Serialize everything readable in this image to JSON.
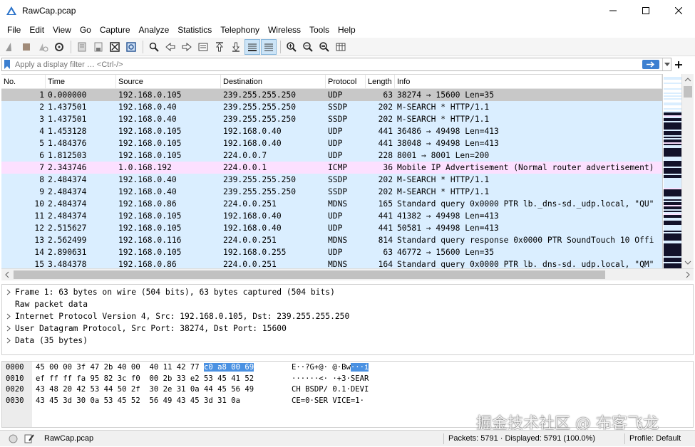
{
  "window": {
    "title": "RawCap.pcap"
  },
  "menu": [
    "File",
    "Edit",
    "View",
    "Go",
    "Capture",
    "Analyze",
    "Statistics",
    "Telephony",
    "Wireless",
    "Tools",
    "Help"
  ],
  "toolbar_icons": [
    "shark-fin-icon",
    "stop-icon",
    "restart-icon",
    "options-icon",
    "open-icon",
    "save-icon",
    "close-file-icon",
    "reload-icon",
    "find-icon",
    "back-icon",
    "forward-icon",
    "go-to-packet-icon",
    "first-packet-icon",
    "last-packet-icon",
    "autoscroll-icon",
    "colorize-icon",
    "zoom-in-icon",
    "zoom-out-icon",
    "normal-size-icon",
    "resize-columns-icon"
  ],
  "filter": {
    "placeholder": "Apply a display filter … <Ctrl-/>"
  },
  "packet_list": {
    "columns": [
      "No.",
      "Time",
      "Source",
      "Destination",
      "Protocol",
      "Length",
      "Info"
    ],
    "rows": [
      {
        "no": "1",
        "time": "0.000000",
        "src": "192.168.0.105",
        "dst": "239.255.255.250",
        "proto": "UDP",
        "len": "63",
        "info": "38274 → 15600 Len=35",
        "color": "#c8c8c8"
      },
      {
        "no": "2",
        "time": "1.437501",
        "src": "192.168.0.40",
        "dst": "239.255.255.250",
        "proto": "SSDP",
        "len": "202",
        "info": "M-SEARCH * HTTP/1.1",
        "color": "#daeeff"
      },
      {
        "no": "3",
        "time": "1.437501",
        "src": "192.168.0.40",
        "dst": "239.255.255.250",
        "proto": "SSDP",
        "len": "202",
        "info": "M-SEARCH * HTTP/1.1",
        "color": "#daeeff"
      },
      {
        "no": "4",
        "time": "1.453128",
        "src": "192.168.0.105",
        "dst": "192.168.0.40",
        "proto": "UDP",
        "len": "441",
        "info": "36486 → 49498 Len=413",
        "color": "#daeeff"
      },
      {
        "no": "5",
        "time": "1.484376",
        "src": "192.168.0.105",
        "dst": "192.168.0.40",
        "proto": "UDP",
        "len": "441",
        "info": "38048 → 49498 Len=413",
        "color": "#daeeff"
      },
      {
        "no": "6",
        "time": "1.812503",
        "src": "192.168.0.105",
        "dst": "224.0.0.7",
        "proto": "UDP",
        "len": "228",
        "info": "8001 → 8001 Len=200",
        "color": "#daeeff"
      },
      {
        "no": "7",
        "time": "2.343746",
        "src": "1.0.168.192",
        "dst": "224.0.0.1",
        "proto": "ICMP",
        "len": "36",
        "info": "Mobile IP Advertisement (Normal router advertisement)",
        "color": "#fce0ff"
      },
      {
        "no": "8",
        "time": "2.484374",
        "src": "192.168.0.40",
        "dst": "239.255.255.250",
        "proto": "SSDP",
        "len": "202",
        "info": "M-SEARCH * HTTP/1.1",
        "color": "#daeeff"
      },
      {
        "no": "9",
        "time": "2.484374",
        "src": "192.168.0.40",
        "dst": "239.255.255.250",
        "proto": "SSDP",
        "len": "202",
        "info": "M-SEARCH * HTTP/1.1",
        "color": "#daeeff"
      },
      {
        "no": "10",
        "time": "2.484374",
        "src": "192.168.0.86",
        "dst": "224.0.0.251",
        "proto": "MDNS",
        "len": "165",
        "info": "Standard query 0x0000 PTR lb._dns-sd._udp.local, \"QU\"",
        "color": "#daeeff"
      },
      {
        "no": "11",
        "time": "2.484374",
        "src": "192.168.0.105",
        "dst": "192.168.0.40",
        "proto": "UDP",
        "len": "441",
        "info": "41382 → 49498 Len=413",
        "color": "#daeeff"
      },
      {
        "no": "12",
        "time": "2.515627",
        "src": "192.168.0.105",
        "dst": "192.168.0.40",
        "proto": "UDP",
        "len": "441",
        "info": "50581 → 49498 Len=413",
        "color": "#daeeff"
      },
      {
        "no": "13",
        "time": "2.562499",
        "src": "192.168.0.116",
        "dst": "224.0.0.251",
        "proto": "MDNS",
        "len": "814",
        "info": "Standard query response 0x0000 PTR SoundTouch 10 Offi",
        "color": "#daeeff"
      },
      {
        "no": "14",
        "time": "2.890631",
        "src": "192.168.0.105",
        "dst": "192.168.0.255",
        "proto": "UDP",
        "len": "63",
        "info": "46772 → 15600 Len=35",
        "color": "#daeeff"
      },
      {
        "no": "15",
        "time": "3.484378",
        "src": "192.168.0.86",
        "dst": "224.0.0.251",
        "proto": "MDNS",
        "len": "164",
        "info": "Standard query 0x0000 PTR lb._dns-sd._udp.local, \"QM\"",
        "color": "#daeeff"
      }
    ]
  },
  "details": [
    {
      "text": "Frame 1: 63 bytes on wire (504 bits), 63 bytes captured (504 bits)",
      "expandable": true
    },
    {
      "text": "Raw packet data",
      "expandable": false
    },
    {
      "text": "Internet Protocol Version 4, Src: 192.168.0.105, Dst: 239.255.255.250",
      "expandable": true
    },
    {
      "text": "User Datagram Protocol, Src Port: 38274, Dst Port: 15600",
      "expandable": true
    },
    {
      "text": "Data (35 bytes)",
      "expandable": true
    }
  ],
  "bytes": {
    "rows": [
      {
        "offset": "0000",
        "hex_a": "45 00 00 3f 47 2b 40 00  40 11 42 77 ",
        "hex_hl": "c0 a8 00 69",
        "ascii_a": "E··?G+@· @·Bw",
        "ascii_hl": "···i"
      },
      {
        "offset": "0010",
        "hex_a": "ef ff ff fa 95 82 3c f0  00 2b 33 e2 53 45 41 52",
        "hex_hl": "",
        "ascii_a": "······<· ·+3·SEAR",
        "ascii_hl": ""
      },
      {
        "offset": "0020",
        "hex_a": "43 48 20 42 53 44 50 2f  30 2e 31 0a 44 45 56 49",
        "hex_hl": "",
        "ascii_a": "CH BSDP/ 0.1·DEVI",
        "ascii_hl": ""
      },
      {
        "offset": "0030",
        "hex_a": "43 45 3d 30 0a 53 45 52  56 49 43 45 3d 31 0a",
        "hex_hl": "",
        "ascii_a": "CE=0·SER VICE=1·",
        "ascii_hl": ""
      }
    ]
  },
  "watermark": "掘金技术社区 @ 布客飞龙",
  "status": {
    "file": "RawCap.pcap",
    "packets": "Packets: 5791 · Displayed: 5791 (100.0%)",
    "profile": "Profile: Default"
  }
}
